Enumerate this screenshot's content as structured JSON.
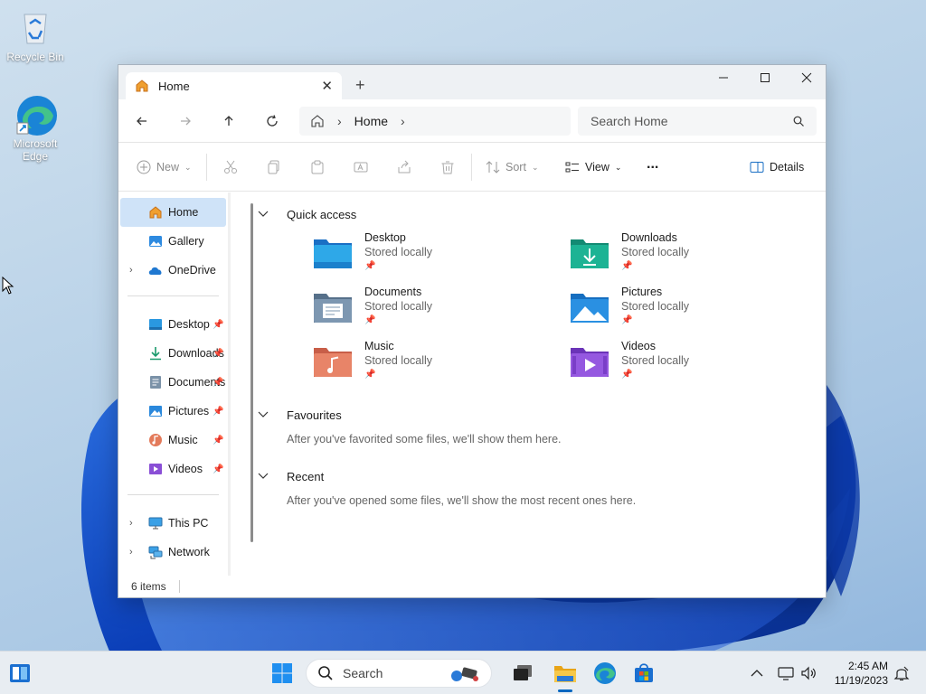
{
  "desktop": {
    "icons": [
      {
        "label": "Recycle Bin"
      },
      {
        "label": "Microsoft Edge"
      }
    ]
  },
  "window": {
    "tab_title": "Home",
    "new_tab_symbol": "+",
    "address": {
      "crumbs": [
        "Home"
      ]
    },
    "search": {
      "placeholder": "Search Home"
    },
    "toolbar": {
      "new_label": "New",
      "sort_label": "Sort",
      "view_label": "View",
      "more_label": "...",
      "details_label": "Details"
    },
    "sidebar": {
      "top": [
        {
          "label": "Home",
          "icon": "home-icon",
          "selected": true
        },
        {
          "label": "Gallery",
          "icon": "gallery-icon"
        },
        {
          "label": "OneDrive",
          "icon": "cloud-icon",
          "expandable": true
        }
      ],
      "pinned": [
        {
          "label": "Desktop",
          "icon": "desktop-folder-icon"
        },
        {
          "label": "Downloads",
          "icon": "download-icon"
        },
        {
          "label": "Documents",
          "icon": "documents-icon"
        },
        {
          "label": "Pictures",
          "icon": "pictures-icon"
        },
        {
          "label": "Music",
          "icon": "music-icon"
        },
        {
          "label": "Videos",
          "icon": "videos-icon"
        }
      ],
      "bottom": [
        {
          "label": "This PC",
          "icon": "computer-icon"
        },
        {
          "label": "Network",
          "icon": "network-icon"
        }
      ]
    },
    "main": {
      "quick_access": {
        "title": "Quick access",
        "items": [
          {
            "name": "Desktop",
            "sub": "Stored locally",
            "color": "#1e90d8"
          },
          {
            "name": "Downloads",
            "sub": "Stored locally",
            "color": "#1aa68c"
          },
          {
            "name": "Documents",
            "sub": "Stored locally",
            "color": "#6f8aa6"
          },
          {
            "name": "Pictures",
            "sub": "Stored locally",
            "color": "#1e88d8"
          },
          {
            "name": "Music",
            "sub": "Stored locally",
            "color": "#e0785a"
          },
          {
            "name": "Videos",
            "sub": "Stored locally",
            "color": "#8a4fd6"
          }
        ]
      },
      "favourites": {
        "title": "Favourites",
        "note": "After you've favorited some files, we'll show them here."
      },
      "recent": {
        "title": "Recent",
        "note": "After you've opened some files, we'll show the most recent ones here."
      }
    },
    "status": {
      "items_count": "6 items"
    }
  },
  "taskbar": {
    "search_placeholder": "Search",
    "clock": {
      "time": "2:45 AM",
      "date": "11/19/2023"
    }
  }
}
